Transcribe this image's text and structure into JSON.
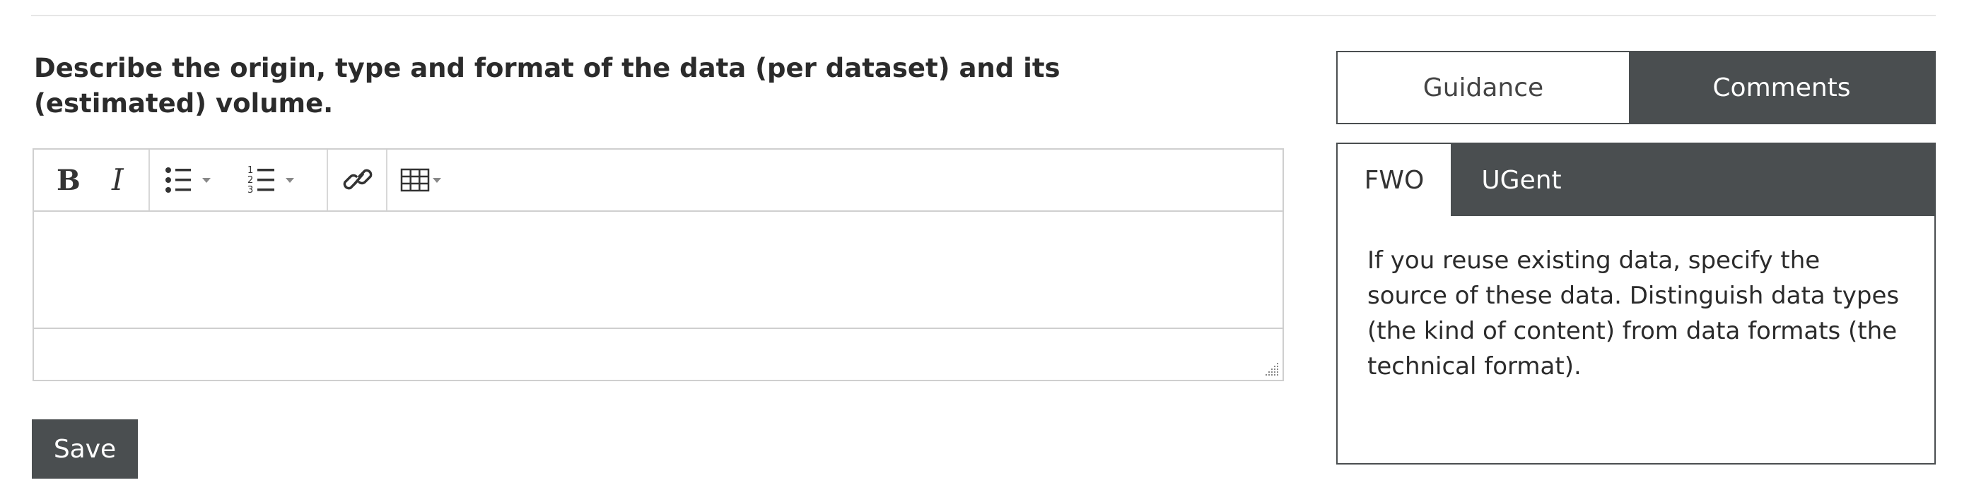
{
  "question": {
    "text": "Describe the origin, type and format of the data (per dataset) and its (estimated) volume."
  },
  "editor": {
    "toolbar": {
      "bold_label": "B",
      "italic_label": "I",
      "icons": [
        "bold-icon",
        "italic-icon",
        "bullet-list-icon",
        "numbered-list-icon",
        "link-icon",
        "table-icon"
      ]
    },
    "content": ""
  },
  "save_button": {
    "label": "Save"
  },
  "side_tabs": {
    "items": [
      {
        "label": "Guidance",
        "active": false
      },
      {
        "label": "Comments",
        "active": true
      }
    ]
  },
  "comment_panel": {
    "org_tabs": [
      {
        "label": "FWO",
        "selected": true
      },
      {
        "label": "UGent",
        "selected": false
      }
    ],
    "text": "If you reuse existing data, specify the source of these data. Distinguish data types (the kind of content) from data formats (the technical format)."
  },
  "colors": {
    "accent_dark": "#4a4e50",
    "border_light": "#cfcfcf",
    "text": "#2b2b2b"
  }
}
